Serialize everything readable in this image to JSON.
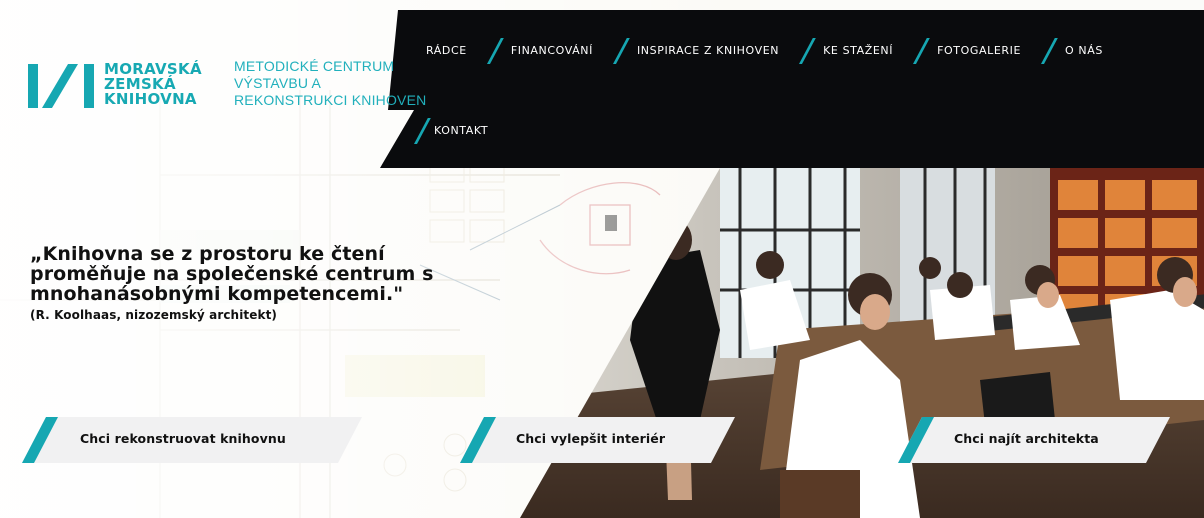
{
  "brand": {
    "logo_lines": [
      "MORAVSKÁ",
      "ZEMSKÁ",
      "KNIHOVNA"
    ],
    "subtitle_lines": [
      "METODICKÉ CENTRUM",
      "VÝSTAVBU A",
      "REKONSTRUKCI KNIHOVEN"
    ]
  },
  "nav": {
    "items": [
      {
        "label": "RÁDCE"
      },
      {
        "label": "FINANCOVÁNÍ"
      },
      {
        "label": "INSPIRACE Z KNIHOVEN"
      },
      {
        "label": "KE STAŽENÍ"
      },
      {
        "label": "FOTOGALERIE"
      },
      {
        "label": "O NÁS"
      },
      {
        "label": "KONTAKT"
      }
    ]
  },
  "hero": {
    "quote_lines": [
      "„Knihovna se z prostoru ke čtení",
      "proměňuje na společenské centrum s",
      "mnohanásobnými kompetencemi.\""
    ],
    "author": "(R. Koolhaas, nizozemský architekt)"
  },
  "cta": [
    {
      "label": "Chci rekonstruovat knihovnu"
    },
    {
      "label": "Chci vylepšit interiér"
    },
    {
      "label": "Chci najít architekta"
    }
  ],
  "colors": {
    "accent": "#16a7b2",
    "nav_bg": "#0a0b0d",
    "cta_bg": "#f3f3f3"
  }
}
